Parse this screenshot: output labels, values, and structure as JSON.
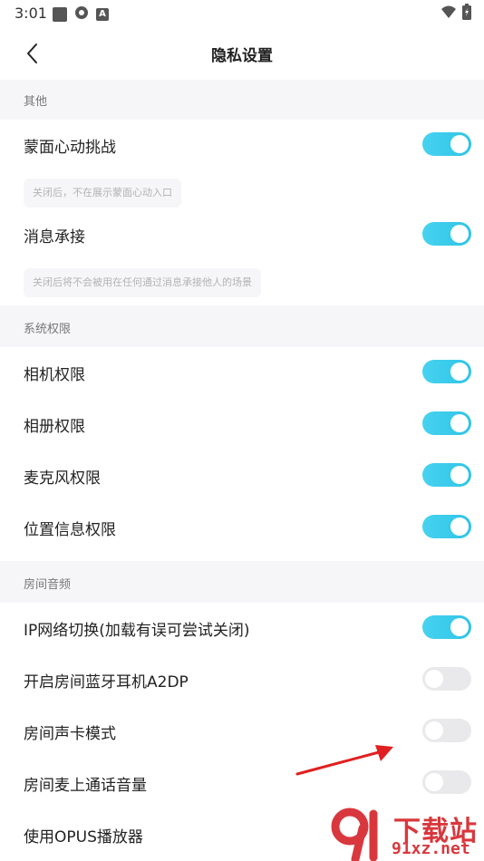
{
  "status_bar": {
    "time": "3:01"
  },
  "header": {
    "title": "隐私设置"
  },
  "sections": [
    {
      "label": "其他",
      "items": [
        {
          "label": "蒙面心动挑战",
          "on": true,
          "hint": "关闭后，不在展示蒙面心动入口"
        },
        {
          "label": "消息承接",
          "on": true,
          "hint": "关闭后将不会被用在任何通过消息承接他人的场景"
        }
      ]
    },
    {
      "label": "系统权限",
      "items": [
        {
          "label": "相机权限",
          "on": true
        },
        {
          "label": "相册权限",
          "on": true
        },
        {
          "label": "麦克风权限",
          "on": true
        },
        {
          "label": "位置信息权限",
          "on": true
        }
      ]
    },
    {
      "label": "房间音频",
      "items": [
        {
          "label": "IP网络切换(加载有误可尝试关闭)",
          "on": true
        },
        {
          "label": "开启房间蓝牙耳机A2DP",
          "on": false
        },
        {
          "label": "房间声卡模式",
          "on": false
        },
        {
          "label": "房间麦上通话音量",
          "on": false
        },
        {
          "label": "使用OPUS播放器"
        }
      ]
    }
  ],
  "watermark": {
    "line1": "下载站",
    "line2": "91xz.net"
  },
  "colors": {
    "toggle_on": "#33c6e8",
    "toggle_off": "#e9e9eb",
    "section_bg": "#f6f6f8",
    "annotation_arrow": "#e02020"
  }
}
